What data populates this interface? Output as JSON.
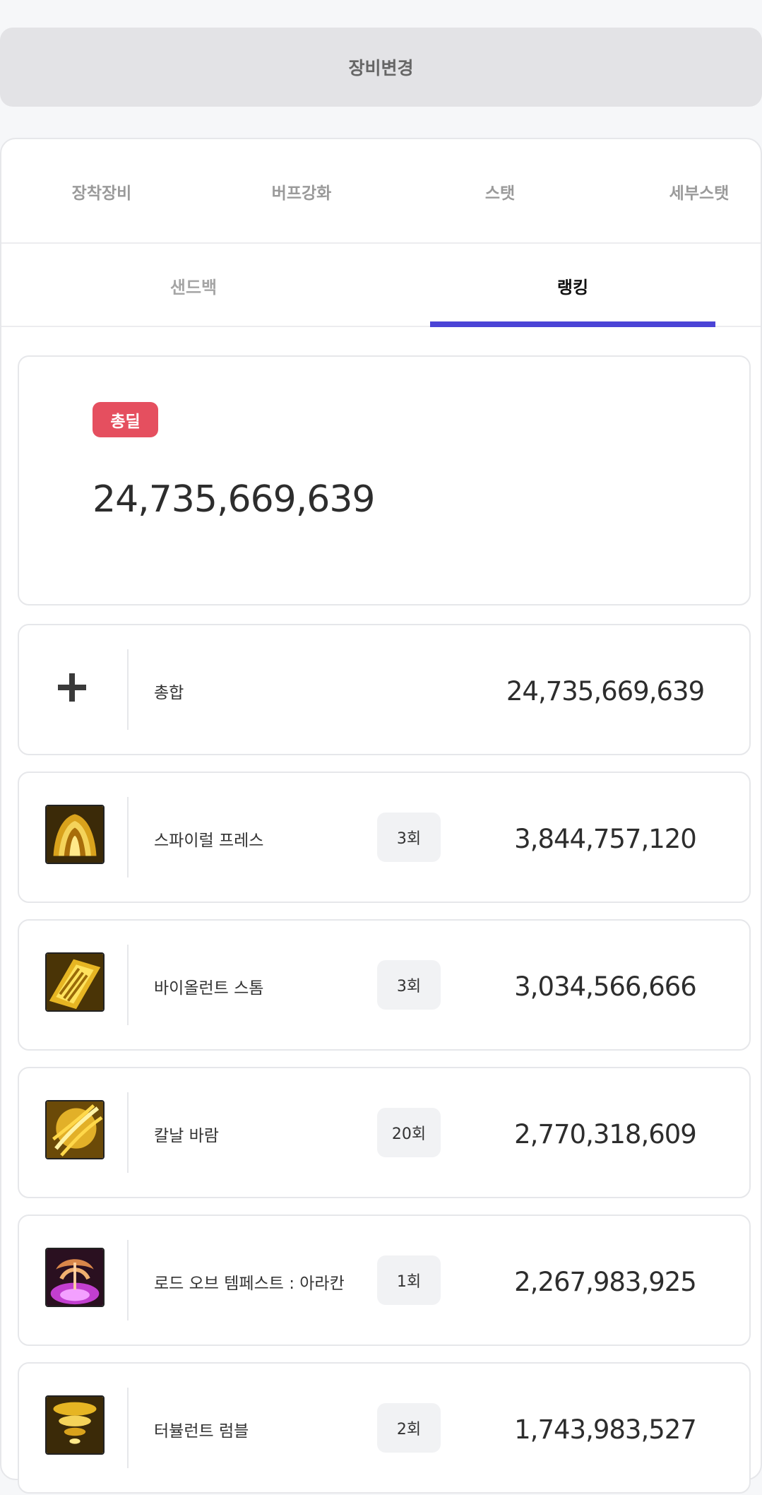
{
  "header": {
    "change_equipment_label": "장비변경"
  },
  "tabs_top": [
    "장착장비",
    "버프강화",
    "스탯",
    "세부스탯"
  ],
  "tabs_sub": [
    "샌드백",
    "랭킹"
  ],
  "active_sub_tab": "랭킹",
  "total": {
    "badge": "총딜",
    "value": "24,735,669,639"
  },
  "summary_row": {
    "icon": "plus-icon",
    "name": "총합",
    "value": "24,735,669,639"
  },
  "skills": [
    {
      "icon": "spiral-press-skill-icon",
      "name": "스파이럴 프레스",
      "count": "3회",
      "value": "3,844,757,120"
    },
    {
      "icon": "violent-storm-skill-icon",
      "name": "바이올런트 스톰",
      "count": "3회",
      "value": "3,034,566,666"
    },
    {
      "icon": "blade-wind-skill-icon",
      "name": "칼날 바람",
      "count": "20회",
      "value": "2,770,318,609"
    },
    {
      "icon": "lord-of-tempest-skill-icon",
      "name": "로드 오브 템페스트 : 아라칸",
      "count": "1회",
      "value": "2,267,983,925"
    },
    {
      "icon": "turbulent-rumble-skill-icon",
      "name": "터뷸런트 럼블",
      "count": "2회",
      "value": "1,743,983,527"
    }
  ],
  "colors": {
    "accent": "#4b44d6",
    "badge": "#e54f5f"
  }
}
